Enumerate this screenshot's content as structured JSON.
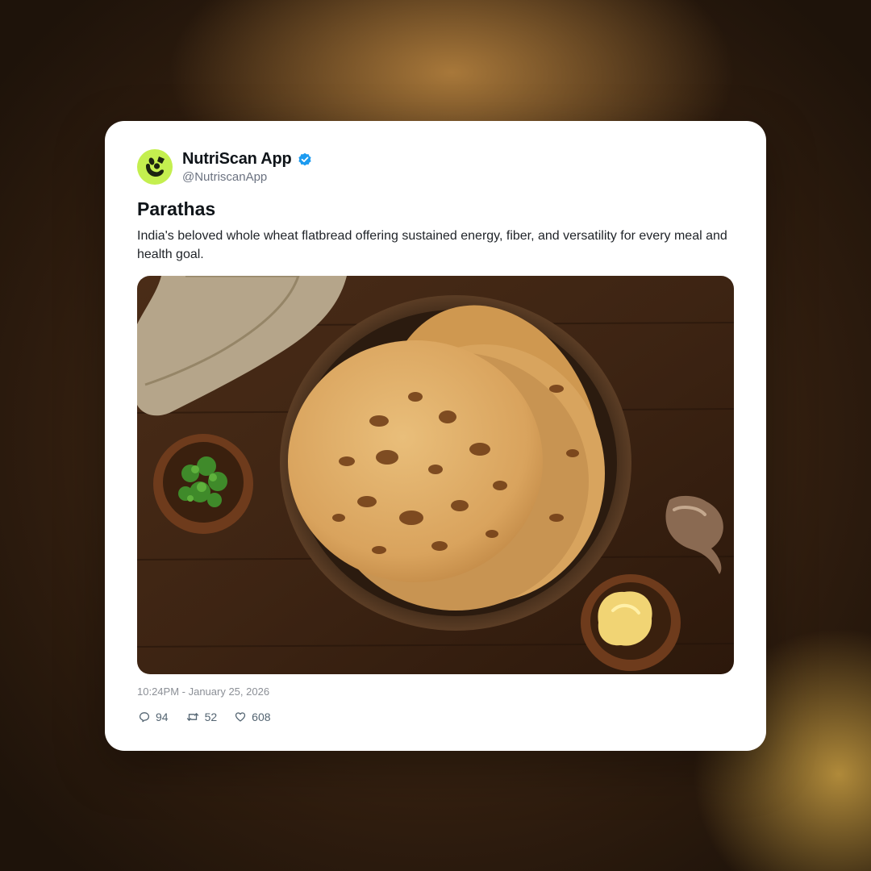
{
  "post": {
    "author_name": "NutriScan App",
    "author_handle": "@NutriscanApp",
    "verified": true,
    "title": "Parathas",
    "description": "India's beloved whole wheat flatbread offering sustained energy, fiber, and versatility for every meal and health goal.",
    "timestamp": "10:24PM - January 25, 2026",
    "stats": {
      "replies": "94",
      "reposts": "52",
      "likes": "608"
    }
  },
  "icons": {
    "avatar": "nutriscan-logo-icon",
    "verified": "verified-badge-icon",
    "reply": "reply-icon",
    "repost": "repost-icon",
    "like": "heart-icon"
  },
  "colors": {
    "avatar_bg": "#c4ef4f",
    "verified_blue": "#1d9bf0",
    "card_bg": "#ffffff"
  }
}
